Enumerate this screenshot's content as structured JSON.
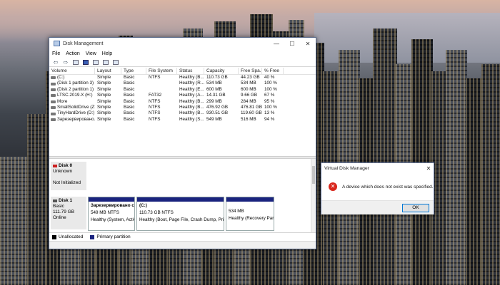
{
  "window": {
    "title": "Disk Management",
    "minimize_glyph": "—",
    "maximize_glyph": "☐",
    "close_glyph": "✕"
  },
  "menu": [
    "File",
    "Action",
    "View",
    "Help"
  ],
  "toolbar": {
    "back_glyph": "⇦",
    "forward_glyph": "⇨",
    "icons": [
      "back-icon",
      "forward-icon",
      "properties-icon",
      "help-icon",
      "console-icon",
      "check-icon",
      "refresh-icon"
    ]
  },
  "volume_table": {
    "columns": [
      "Volume",
      "Layout",
      "Type",
      "File System",
      "Status",
      "Capacity",
      "Free Spa...",
      "% Free"
    ],
    "rows": [
      [
        "(C:)",
        "Simple",
        "Basic",
        "NTFS",
        "Healthy (B...",
        "110.73 GB",
        "44.23 GB",
        "40 %"
      ],
      [
        "(Disk 1 partition 3)",
        "Simple",
        "Basic",
        "",
        "Healthy (R...",
        "534 MB",
        "534 MB",
        "100 %"
      ],
      [
        "(Disk 2 partition 1)",
        "Simple",
        "Basic",
        "",
        "Healthy (E...",
        "600 MB",
        "600 MB",
        "100 %"
      ],
      [
        "LTSC.2019.X (H:)",
        "Simple",
        "Basic",
        "FAT32",
        "Healthy (A...",
        "14.31 GB",
        "9.66 GB",
        "67 %"
      ],
      [
        "More",
        "Simple",
        "Basic",
        "NTFS",
        "Healthy (B...",
        "299 MB",
        "284 MB",
        "95 %"
      ],
      [
        "SmallSolidDrive (Z:)",
        "Simple",
        "Basic",
        "NTFS",
        "Healthy (B...",
        "476.92 GB",
        "476.81 GB",
        "100 %"
      ],
      [
        "TinyHardDrive (D:)",
        "Simple",
        "Basic",
        "NTFS",
        "Healthy (B...",
        "930.51 GB",
        "119.60 GB",
        "13 %"
      ],
      [
        "Зарезервировано...",
        "Simple",
        "Basic",
        "NTFS",
        "Healthy (S...",
        "549 MB",
        "516 MB",
        "94 %"
      ]
    ]
  },
  "disks": [
    {
      "name": "Disk 0",
      "kind": "Unknown",
      "size": "",
      "status": "Not Initialized",
      "partitions": []
    },
    {
      "name": "Disk 1",
      "kind": "Basic",
      "size": "111.79 GB",
      "status": "Online",
      "partitions": [
        {
          "name": "Зарезервировано си",
          "detail": "549 MB NTFS",
          "health": "Healthy (System, Activ"
        },
        {
          "name": "(C:)",
          "detail": "110.73 GB NTFS",
          "health": "Healthy (Boot, Page File, Crash Dump, Primar"
        },
        {
          "name": "",
          "detail": "534 MB",
          "health": "Healthy (Recovery Parti"
        }
      ]
    }
  ],
  "legend": [
    {
      "label": "Unallocated",
      "color": "#000000"
    },
    {
      "label": "Primary partition",
      "color": "#1a237e"
    }
  ],
  "dialog": {
    "title": "Virtual Disk Manager",
    "message": "A device which does not exist was specified.",
    "ok_label": "OK",
    "close_glyph": "✕",
    "error_glyph": "✕"
  }
}
